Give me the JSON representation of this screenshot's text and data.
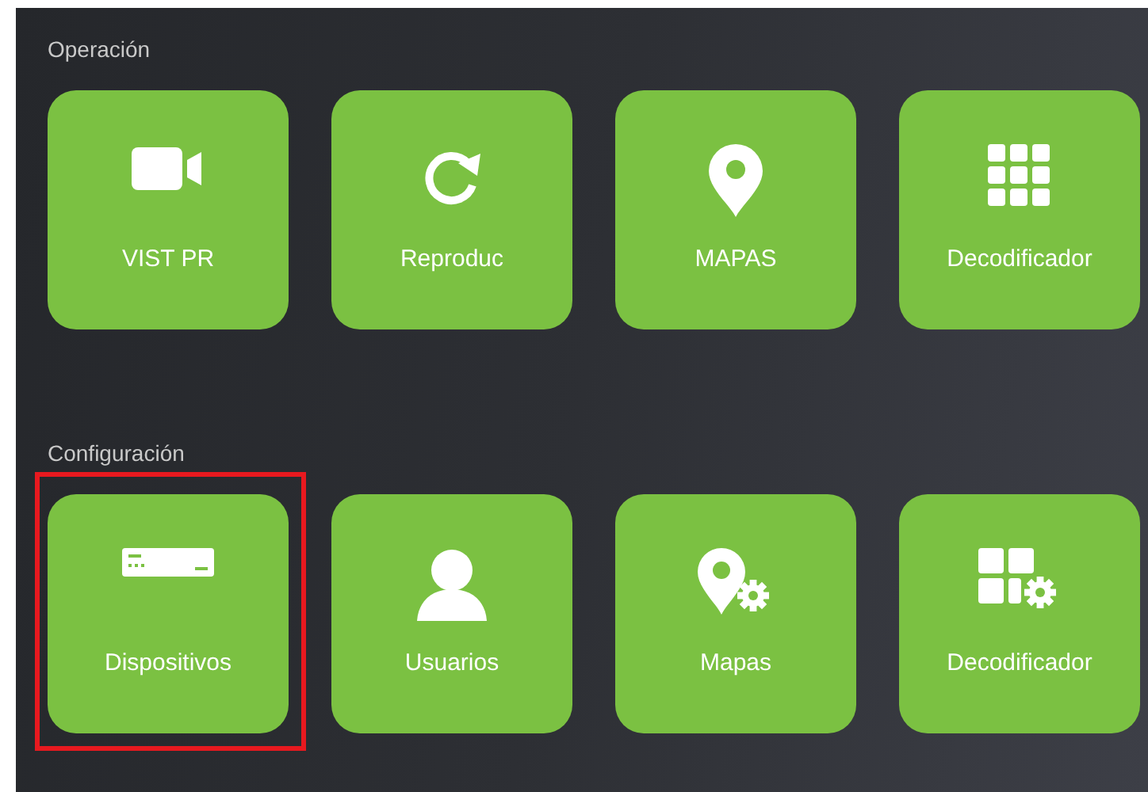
{
  "sections": [
    {
      "title": "Operación",
      "tiles": [
        {
          "label": "VIST PR",
          "highlighted": false
        },
        {
          "label": "Reproduc",
          "highlighted": false
        },
        {
          "label": "MAPAS",
          "highlighted": false
        },
        {
          "label": "Decodificador",
          "highlighted": false
        }
      ]
    },
    {
      "title": "Configuración",
      "tiles": [
        {
          "label": "Dispositivos",
          "highlighted": true
        },
        {
          "label": "Usuarios",
          "highlighted": false
        },
        {
          "label": "Mapas",
          "highlighted": false
        },
        {
          "label": "Decodificador",
          "highlighted": false
        }
      ]
    }
  ]
}
